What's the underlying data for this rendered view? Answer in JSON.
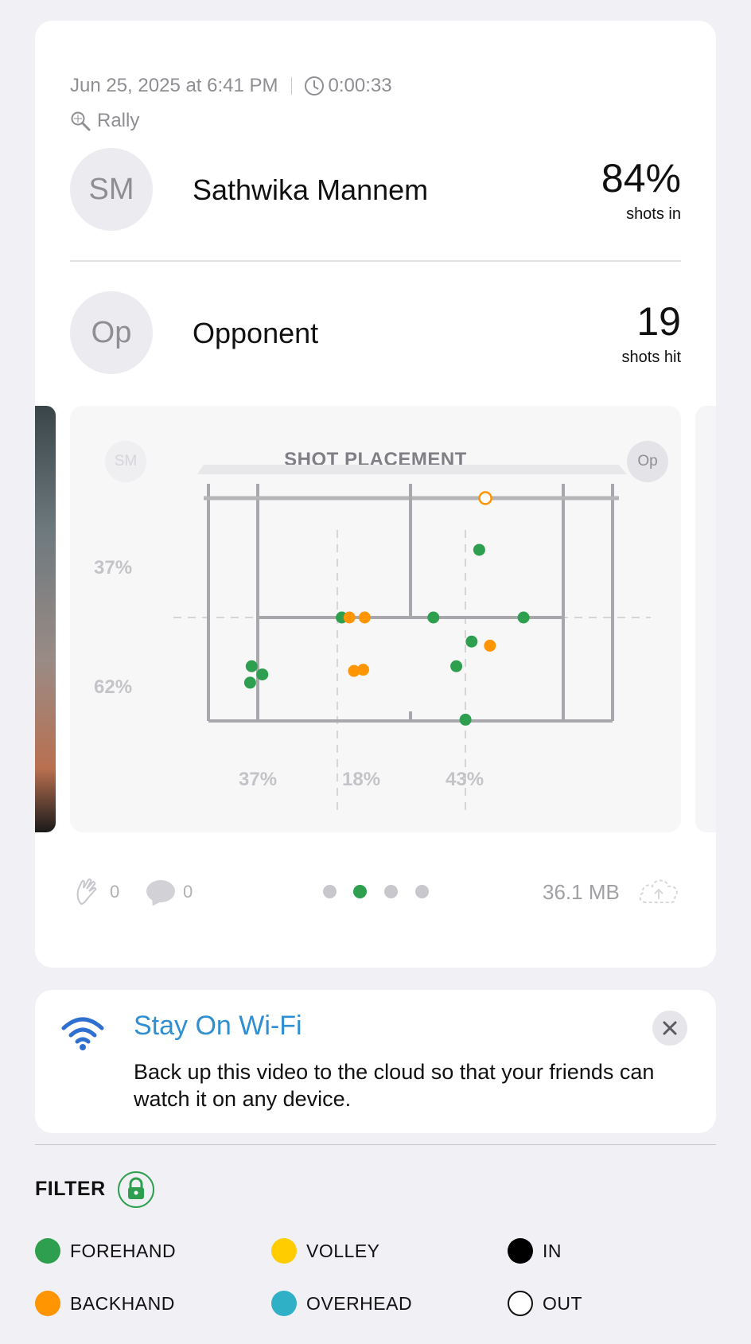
{
  "session": {
    "datetime": "Jun 25, 2025 at 6:41 PM",
    "duration": "0:00:33",
    "type": "Rally"
  },
  "players": [
    {
      "initials": "SM",
      "name": "Sathwika Mannem",
      "stat_value": "84%",
      "stat_label": "shots in"
    },
    {
      "initials": "Op",
      "name": "Opponent",
      "stat_value": "19",
      "stat_label": "shots hit"
    }
  ],
  "chart_data": {
    "type": "scatter",
    "title": "SHOT PLACEMENT",
    "left_avatar": "SM",
    "right_avatar": "Op",
    "depth_percentages": [
      "37%",
      "62%"
    ],
    "zone_percentages": [
      "37%",
      "18%",
      "43%"
    ],
    "series": [
      {
        "name": "FOREHAND",
        "color": "#2d9f4e",
        "points": [
          [
            -0.45,
            1.0
          ],
          [
            0.15,
            1.0
          ],
          [
            0.45,
            0.88
          ],
          [
            0.74,
            1.0
          ],
          [
            -1.04,
            1.83
          ],
          [
            -0.97,
            1.97
          ],
          [
            -1.05,
            2.11
          ],
          [
            0.4,
            1.41
          ],
          [
            0.3,
            1.83
          ],
          [
            0.36,
            2.74
          ]
        ]
      },
      {
        "name": "BACKHAND",
        "color": "#ff9500",
        "points": [
          [
            -0.4,
            1.0
          ],
          [
            -0.3,
            1.0
          ],
          [
            0.52,
            1.48
          ],
          [
            -0.37,
            1.91
          ],
          [
            -0.31,
            1.89
          ]
        ]
      },
      {
        "name": "BACKHAND OUT",
        "color": "#ff9500",
        "hollow": true,
        "points": [
          [
            0.49,
            -2.03
          ]
        ]
      }
    ]
  },
  "footer": {
    "claps": "0",
    "comments": "0",
    "pages": 4,
    "active_page": 1,
    "file_size": "36.1 MB"
  },
  "wifi": {
    "title": "Stay On Wi-Fi",
    "body": "Back up this video to the cloud so that your friends can watch it on any device."
  },
  "filter": {
    "label": "FILTER",
    "legend": [
      {
        "label": "FOREHAND",
        "color": "#2d9f4e",
        "outline": false
      },
      {
        "label": "VOLLEY",
        "color": "#ffcc00",
        "outline": false
      },
      {
        "label": "IN",
        "color": "#000000",
        "outline": false
      },
      {
        "label": "BACKHAND",
        "color": "#ff9500",
        "outline": false
      },
      {
        "label": "OVERHEAD",
        "color": "#30b0c7",
        "outline": false
      },
      {
        "label": "OUT",
        "color": "#ffffff",
        "outline": true
      }
    ]
  }
}
